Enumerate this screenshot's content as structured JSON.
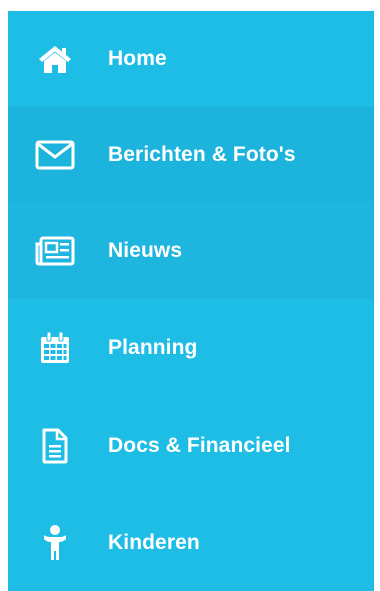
{
  "sidebar": {
    "items": [
      {
        "label": "Home",
        "icon": "home-icon"
      },
      {
        "label": "Berichten & Foto's",
        "icon": "envelope-icon"
      },
      {
        "label": "Nieuws",
        "icon": "newspaper-icon"
      },
      {
        "label": "Planning",
        "icon": "calendar-icon"
      },
      {
        "label": "Docs & Financieel",
        "icon": "document-icon"
      },
      {
        "label": "Kinderen",
        "icon": "child-icon"
      }
    ]
  },
  "colors": {
    "sidebar_bg": "#1dbde6",
    "active_bg": "#1cb4dc",
    "text": "#ffffff"
  }
}
